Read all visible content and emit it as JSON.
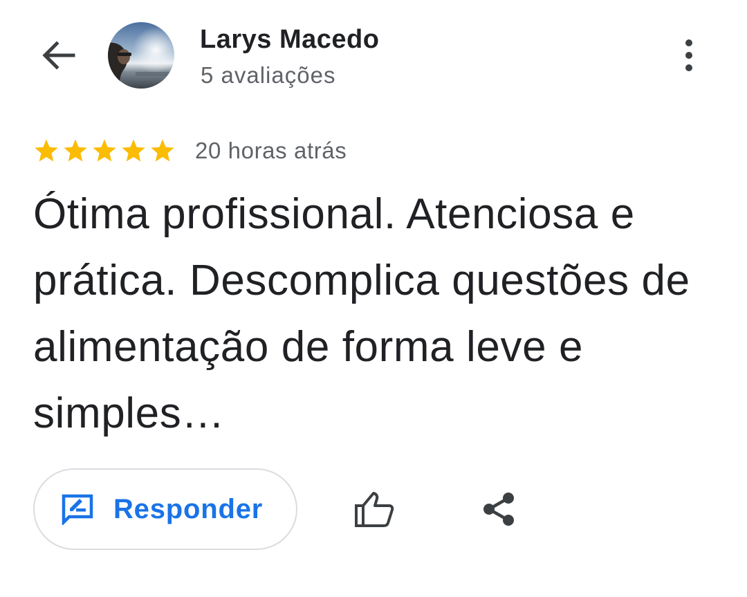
{
  "header": {
    "user_name": "Larys Macedo",
    "review_count": "5 avaliações",
    "back_icon": "arrow-back-icon",
    "more_icon": "more-vert-icon"
  },
  "review": {
    "rating": 5,
    "rating_max": 5,
    "time_ago": "20 horas atrás",
    "text": "Ótima profissional. Atenciosa e prática. Descomplica questões de alimentação de forma leve e simples…"
  },
  "actions": {
    "reply_label": "Responder",
    "reply_icon": "rate-review-icon",
    "like_icon": "thumb-up-icon",
    "share_icon": "share-icon"
  },
  "colors": {
    "star": "#FBBC04",
    "accent": "#1a73e8",
    "primary_text": "#202124",
    "secondary_text": "#5f6368",
    "border": "#dadce0"
  }
}
